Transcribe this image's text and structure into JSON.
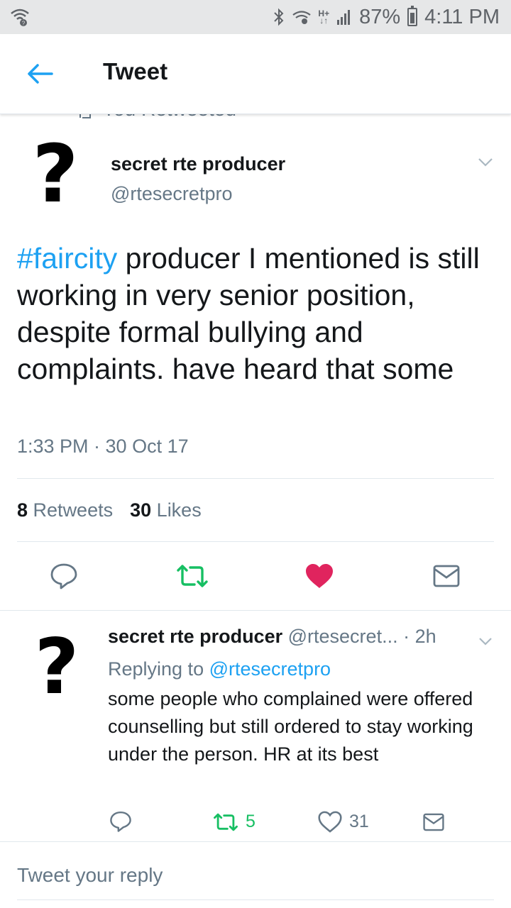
{
  "status_bar": {
    "battery": "87%",
    "time": "4:11 PM",
    "network": "H+"
  },
  "app_bar": {
    "title": "Tweet"
  },
  "context": {
    "label": "You Retweeted"
  },
  "tweet": {
    "name": "secret rte producer",
    "handle": "@rtesecretpro",
    "avatar": "?",
    "hashtag": "#faircity",
    "text": " producer I mentioned is still working in very senior position,  despite formal bullying and complaints. have heard that some",
    "timestamp": "1:33 PM · 30 Oct 17",
    "retweets_count": "8",
    "retweets_label": "Retweets",
    "likes_count": "30",
    "likes_label": "Likes"
  },
  "reply": {
    "name": "secret rte producer",
    "handle": "@rtesecret...",
    "time": "· 2h",
    "avatar": "?",
    "replying_prefix": "Replying to",
    "replying_to": "@rtesecretpro",
    "text": "some people who complained were offered counselling but still ordered to stay working under the person. HR at its best",
    "retweets": "5",
    "likes": "31"
  },
  "compose": {
    "placeholder": "Tweet your reply"
  },
  "colors": {
    "accent": "#1da1f2",
    "retweet": "#17bf63",
    "like": "#e0245e",
    "muted": "#657786"
  },
  "icons": [
    "wifi-icon",
    "bluetooth-icon",
    "signal-icon",
    "battery-icon",
    "back-arrow-icon",
    "chevron-down-icon",
    "reply-icon",
    "retweet-icon",
    "heart-icon",
    "mail-icon"
  ]
}
